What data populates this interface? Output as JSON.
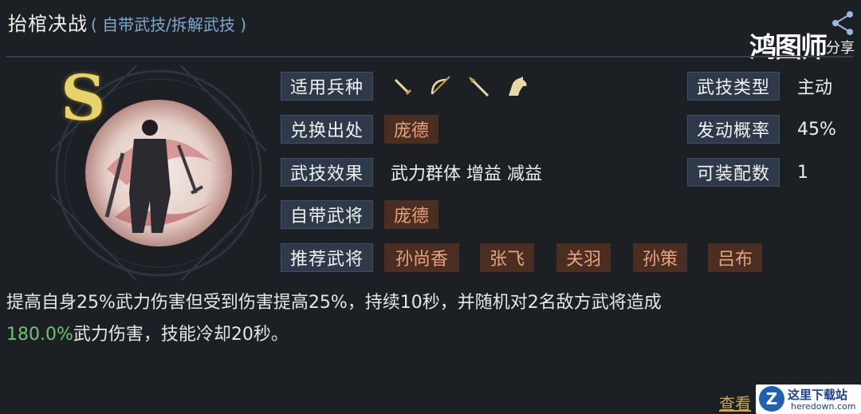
{
  "header": {
    "title": "抬棺决战",
    "subtitle": "( 自带武技/拆解武技 )"
  },
  "watermark": {
    "brand": "鸿图师",
    "share": "分享"
  },
  "skill": {
    "grade": "S"
  },
  "fields": {
    "troop_label": "适用兵种",
    "troop_icons": [
      "sword-icon",
      "bow-icon",
      "spear-icon",
      "horse-icon"
    ],
    "source_label": "兑换出处",
    "source_value": "庞德",
    "effect_label": "武技效果",
    "effect_value": "武力群体  增益  减益",
    "own_label": "自带武将",
    "own_value": "庞德",
    "recommend_label": "推荐武将",
    "recommend": [
      "孙尚香",
      "张飞",
      "关羽",
      "孙策",
      "吕布"
    ],
    "type_label": "武技类型",
    "type_value": "主动",
    "rate_label": "发动概率",
    "rate_value": "45%",
    "slots_label": "可装配数",
    "slots_value": "1"
  },
  "description": {
    "line1": "提高自身25%武力伤害但受到伤害提高25%，持续10秒，并随机对2名敌方武将造成",
    "highlight": "180.0%",
    "line2_rest": "武力伤害，技能冷却20秒。"
  },
  "footer": {
    "more_link": "查看",
    "site_cn": "这里下载站",
    "site_en": "heredown.com"
  },
  "colors": {
    "background": "#1c2025",
    "label_bg": "#2e3a4a",
    "chip_bg": "#4a2e22",
    "chip_text": "#e9a37d",
    "highlight": "#6fc46f",
    "subtitle": "#7fa7cc"
  }
}
